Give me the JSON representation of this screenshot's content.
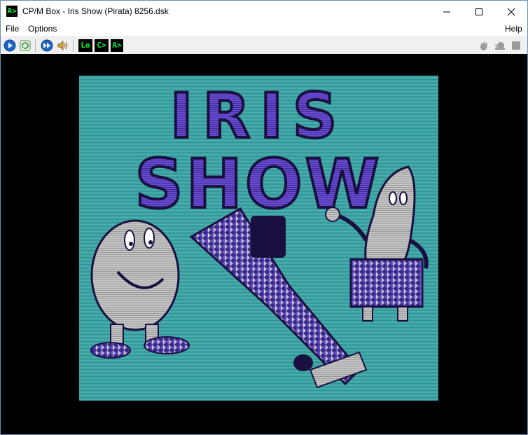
{
  "window": {
    "title": "CP/M Box - Iris Show (Pirata) 8256.dsk",
    "app_icon_text": "A>",
    "minimize_glyph": "—",
    "maximize_glyph": "☐",
    "close_glyph": "✕"
  },
  "menubar": {
    "file": "File",
    "options": "Options",
    "help": "Help"
  },
  "toolbar": {
    "term_lo": "Lo",
    "term_c": "C>",
    "term_a": "A>",
    "icons": [
      "play-icon",
      "refresh-icon",
      "fast-forward-icon",
      "speaker-icon",
      "hand-icon",
      "snail-icon",
      "stop-icon"
    ]
  },
  "screen": {
    "title_line1": "IRIS",
    "title_line2": "SHOW",
    "background_color": "#000000",
    "game_bg_color": "#3aa0a0",
    "letter_color": "#6a4bd6"
  }
}
